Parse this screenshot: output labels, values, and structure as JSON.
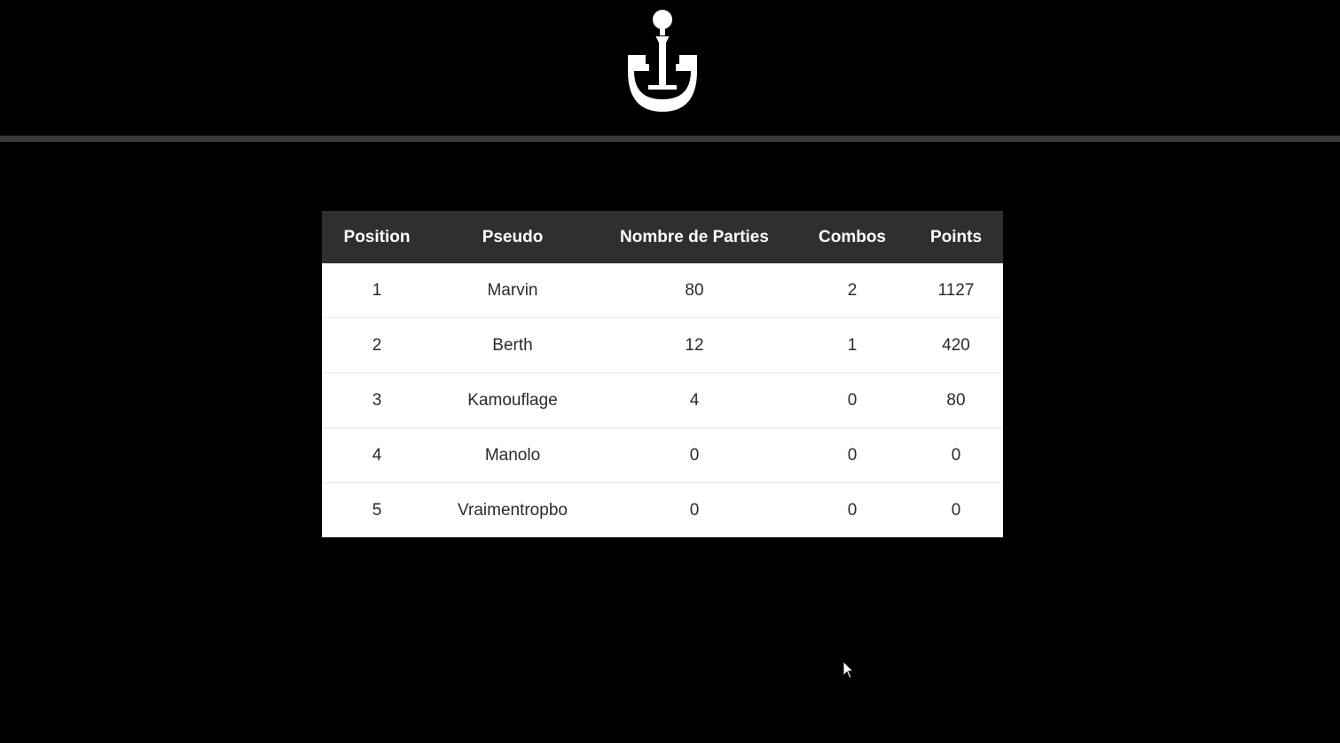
{
  "leaderboard": {
    "columns": [
      "Position",
      "Pseudo",
      "Nombre de Parties",
      "Combos",
      "Points"
    ],
    "rows": [
      [
        "1",
        "Marvin",
        "80",
        "2",
        "1127"
      ],
      [
        "2",
        "Berth",
        "12",
        "1",
        "420"
      ],
      [
        "3",
        "Kamouflage",
        "4",
        "0",
        "80"
      ],
      [
        "4",
        "Manolo",
        "0",
        "0",
        "0"
      ],
      [
        "5",
        "Vraimentropbo",
        "0",
        "0",
        "0"
      ]
    ]
  },
  "icons": {
    "logo": "anchor-logo-icon",
    "cursor": "mouse-pointer-icon"
  },
  "colors": {
    "background": "#000000",
    "header_divider": "#3a3a3a",
    "table_header_bg": "#2f2f2f",
    "table_header_text": "#ffffff",
    "table_row_bg": "#ffffff",
    "table_row_text": "#2b2b2b"
  }
}
